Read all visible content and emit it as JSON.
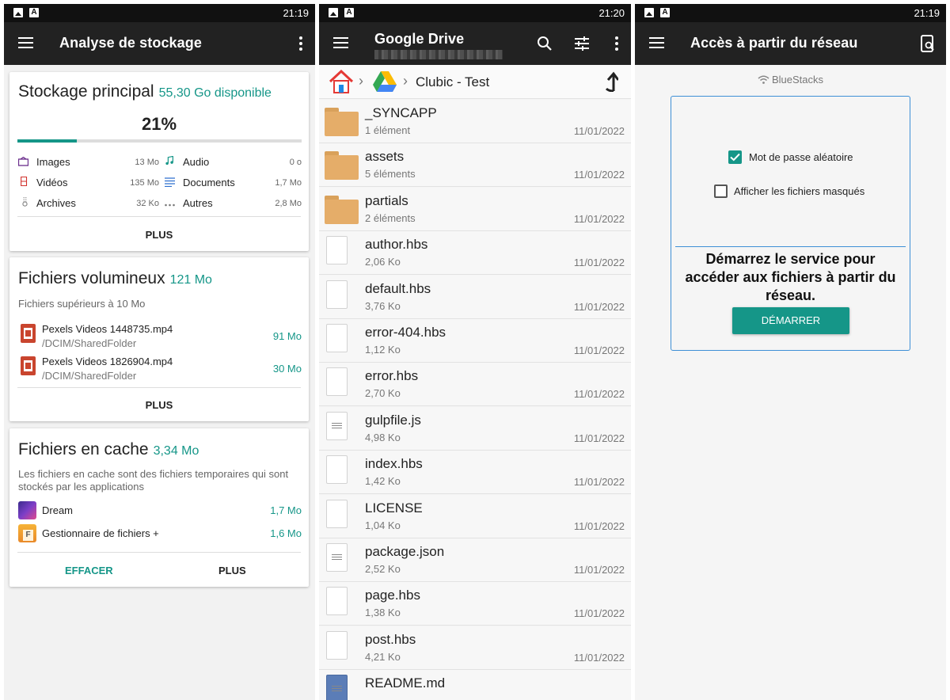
{
  "colors": {
    "accent": "#159688",
    "appbar": "#222222",
    "statusbar": "#111111"
  },
  "left": {
    "status_time": "21:19",
    "title": "Analyse de stockage",
    "main_storage": {
      "title": "Stockage principal",
      "available": "55,30 Go disponible",
      "percent_label": "21%",
      "used_fraction": 0.21,
      "categories": [
        {
          "name": "Images",
          "size": "13 Mo",
          "icon": "image-icon"
        },
        {
          "name": "Vidéos",
          "size": "135 Mo",
          "icon": "video-icon"
        },
        {
          "name": "Archives",
          "size": "32 Ko",
          "icon": "archive-icon"
        },
        {
          "name": "Audio",
          "size": "0 o",
          "icon": "music-icon"
        },
        {
          "name": "Documents",
          "size": "1,7 Mo",
          "icon": "document-icon"
        },
        {
          "name": "Autres",
          "size": "2,8 Mo",
          "icon": "more-icon"
        }
      ],
      "more_label": "PLUS"
    },
    "large_files": {
      "title": "Fichiers volumineux",
      "size": "121 Mo",
      "subtitle": "Fichiers supérieurs à 10 Mo",
      "items": [
        {
          "name": "Pexels Videos 1448735.mp4",
          "path": "/DCIM/SharedFolder",
          "size": "91 Mo"
        },
        {
          "name": "Pexels Videos 1826904.mp4",
          "path": "/DCIM/SharedFolder",
          "size": "30 Mo"
        }
      ],
      "more_label": "PLUS"
    },
    "cache": {
      "title": "Fichiers en cache",
      "size": "3,34 Mo",
      "description": "Les fichiers en cache sont des fichiers temporaires qui sont stockés par les applications",
      "items": [
        {
          "name": "Dream",
          "size": "1,7 Mo"
        },
        {
          "name": "Gestionnaire de fichiers +",
          "size": "1,6 Mo"
        }
      ],
      "clear_label": "EFFACER",
      "more_label": "PLUS"
    }
  },
  "middle": {
    "status_time": "21:20",
    "title": "Google Drive",
    "breadcrumb_folder": "Clubic - Test",
    "files": [
      {
        "name": "_SYNCAPP",
        "sub": "1 élément",
        "date": "11/01/2022",
        "kind": "folder"
      },
      {
        "name": "assets",
        "sub": "5 éléments",
        "date": "11/01/2022",
        "kind": "folder"
      },
      {
        "name": "partials",
        "sub": "2 éléments",
        "date": "11/01/2022",
        "kind": "folder"
      },
      {
        "name": "author.hbs",
        "sub": "2,06 Ko",
        "date": "11/01/2022",
        "kind": "file"
      },
      {
        "name": "default.hbs",
        "sub": "3,76 Ko",
        "date": "11/01/2022",
        "kind": "file"
      },
      {
        "name": "error-404.hbs",
        "sub": "1,12 Ko",
        "date": "11/01/2022",
        "kind": "file"
      },
      {
        "name": "error.hbs",
        "sub": "2,70 Ko",
        "date": "11/01/2022",
        "kind": "file"
      },
      {
        "name": "gulpfile.js",
        "sub": "4,98 Ko",
        "date": "11/01/2022",
        "kind": "text"
      },
      {
        "name": "index.hbs",
        "sub": "1,42 Ko",
        "date": "11/01/2022",
        "kind": "file"
      },
      {
        "name": "LICENSE",
        "sub": "1,04 Ko",
        "date": "11/01/2022",
        "kind": "file"
      },
      {
        "name": "package.json",
        "sub": "2,52 Ko",
        "date": "11/01/2022",
        "kind": "text"
      },
      {
        "name": "page.hbs",
        "sub": "1,38 Ko",
        "date": "11/01/2022",
        "kind": "file"
      },
      {
        "name": "post.hbs",
        "sub": "4,21 Ko",
        "date": "11/01/2022",
        "kind": "file"
      },
      {
        "name": "README.md",
        "sub": "",
        "date": "",
        "kind": "markdown"
      }
    ]
  },
  "right": {
    "status_time": "21:19",
    "title": "Accès à partir du réseau",
    "network_name": "BlueStacks",
    "random_password_label": "Mot de passe aléatoire",
    "random_password_checked": true,
    "show_hidden_label": "Afficher les fichiers masqués",
    "show_hidden_checked": false,
    "message": "Démarrez le service pour accéder aux fichiers à partir du réseau.",
    "start_label": "DÉMARRER"
  }
}
